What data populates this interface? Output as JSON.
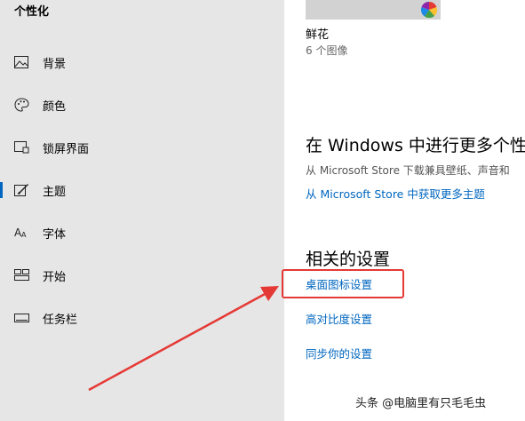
{
  "sidebar": {
    "title": "个性化",
    "items": [
      {
        "label": "背景",
        "icon": "image-icon",
        "active": false
      },
      {
        "label": "颜色",
        "icon": "palette-icon",
        "active": false
      },
      {
        "label": "锁屏界面",
        "icon": "lock-screen-icon",
        "active": false
      },
      {
        "label": "主题",
        "icon": "theme-brush-icon",
        "active": true
      },
      {
        "label": "字体",
        "icon": "font-icon",
        "active": false
      },
      {
        "label": "开始",
        "icon": "start-grid-icon",
        "active": false
      },
      {
        "label": "任务栏",
        "icon": "taskbar-icon",
        "active": false
      }
    ]
  },
  "theme": {
    "name": "鲜花",
    "count": "6 个图像"
  },
  "more": {
    "heading": "在 Windows 中进行更多个性",
    "description": "从 Microsoft Store 下载兼具壁纸、声音和",
    "link": "从 Microsoft Store 中获取更多主题"
  },
  "related": {
    "heading": "相关的设置",
    "links": [
      "桌面图标设置",
      "高对比度设置",
      "同步你的设置"
    ]
  },
  "watermark": "头条 @电脑里有只毛毛虫",
  "colors": {
    "accent": "#0067c0",
    "highlight": "#e53935",
    "sidebar_bg": "#e6e6e6"
  }
}
